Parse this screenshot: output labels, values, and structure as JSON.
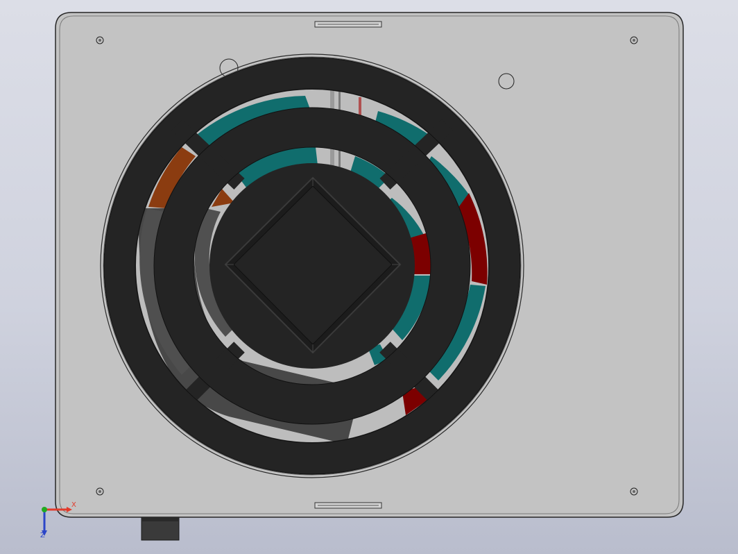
{
  "app": {
    "document_type": "CAD assembly view",
    "view": "front"
  },
  "triad": {
    "x_label": "X",
    "z_label": "Z",
    "x_color": "#e23b2b",
    "z_color": "#2b45c8",
    "origin_color": "#22aa22"
  },
  "colors": {
    "background_top": "#dcdee7",
    "background_bottom": "#b9bdcd",
    "housing": "#c3c3c3",
    "grille": "#242424",
    "blade_teal": "#106d6d",
    "blade_red": "#7c0000",
    "blade_orange": "#8b3c10",
    "blade_gray": "#4d4d4d"
  },
  "icons": {
    "triad": "coordinate-triad-icon",
    "screw": "screw-hole-icon"
  }
}
